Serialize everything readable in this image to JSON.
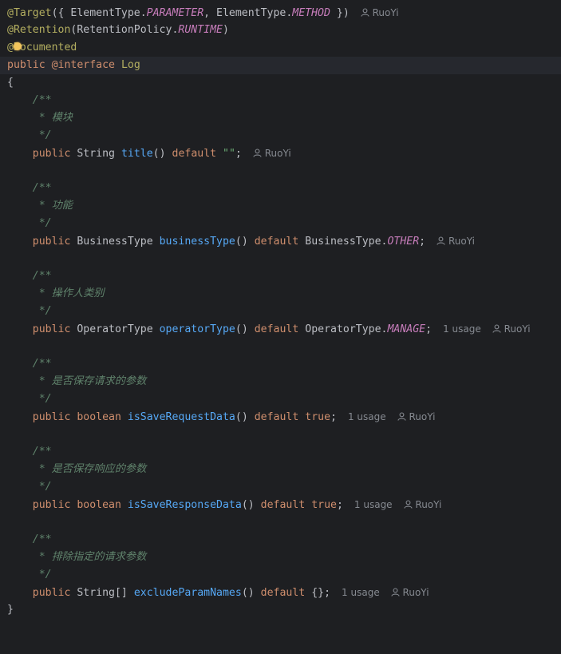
{
  "author": "RuoYi",
  "usage": "1 usage",
  "kw": {
    "public": "public",
    "interface": "@interface",
    "default": "default",
    "boolean": "boolean",
    "true": "true"
  },
  "l1": {
    "a1": "@Target",
    "a2": "({ ElementType.",
    "a3": "PARAMETER",
    "a4": ", ElementType.",
    "a5": "METHOD",
    "a6": " })"
  },
  "l2": {
    "a1": "@Retention",
    "a2": "(RetentionPolicy.",
    "a3": "RUNTIME",
    "a4": ")"
  },
  "l3": {
    "a1": "@",
    "a2": "Documented"
  },
  "l4": {
    "name": "Log"
  },
  "brace_open": "{",
  "brace_close": "}",
  "doc_open": "/**",
  "doc_close": " */",
  "docs": {
    "d1": " * 模块",
    "d2": " * 功能",
    "d3": " * 操作人类别",
    "d4": " * 是否保存请求的参数",
    "d5": " * 是否保存响应的参数",
    "d6": " * 排除指定的请求参数"
  },
  "m1": {
    "type": "String",
    "name": "title",
    "parens": "()",
    "val": "\"\"",
    "end": ";"
  },
  "m2": {
    "type": "BusinessType",
    "name": "businessType",
    "parens": "()",
    "val1": "BusinessType.",
    "val2": "OTHER",
    "end": ";"
  },
  "m3": {
    "type": "OperatorType",
    "name": "operatorType",
    "parens": "()",
    "val1": "OperatorType.",
    "val2": "MANAGE",
    "end": ";"
  },
  "m4": {
    "name": "isSaveRequestData",
    "parens": "()",
    "end": ";"
  },
  "m5": {
    "name": "isSaveResponseData",
    "parens": "()",
    "end": ";"
  },
  "m6": {
    "type": "String[]",
    "name": "excludeParamNames",
    "parens": "()",
    "val": "{}",
    "end": ";"
  },
  "icons": {
    "author": "user-icon",
    "hint": "lightbulb-icon"
  },
  "colors": {
    "background": "#1e1f22",
    "keyword": "#cf8e6d",
    "annotation": "#b3ae60",
    "method": "#56a8f5",
    "constant": "#c77dbb",
    "doc": "#5f826b",
    "string": "#6aab73",
    "text": "#bcbec4"
  }
}
